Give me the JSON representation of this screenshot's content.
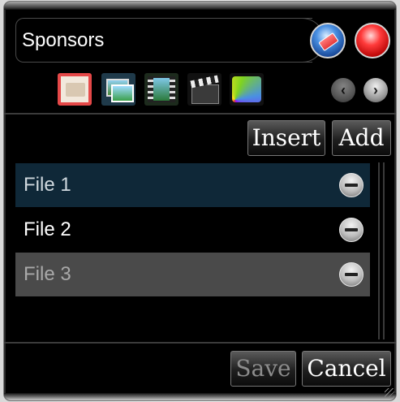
{
  "window": {
    "title": "Sponsors"
  },
  "header_buttons": {
    "clear_icon": "eraser-icon",
    "close_icon": "close-orb-icon"
  },
  "toolbar": {
    "icons": [
      "folder-icon",
      "images-icon",
      "film-icon",
      "clapboard-icon",
      "palette-icon"
    ],
    "prev_glyph": "‹",
    "next_glyph": "›"
  },
  "actions": {
    "insert_label": "Insert",
    "add_label": "Add"
  },
  "files": [
    {
      "label": "File 1",
      "state": "selected"
    },
    {
      "label": "File 2",
      "state": "normal"
    },
    {
      "label": "File 3",
      "state": "disabled"
    }
  ],
  "footer": {
    "save_label": "Save",
    "cancel_label": "Cancel"
  },
  "colors": {
    "panel": "#000000",
    "selected_row": "#0f2838",
    "disabled_row": "#4a4a4a",
    "close_orb": "#ff3b3b",
    "clear_orb": "#4a90e2"
  }
}
